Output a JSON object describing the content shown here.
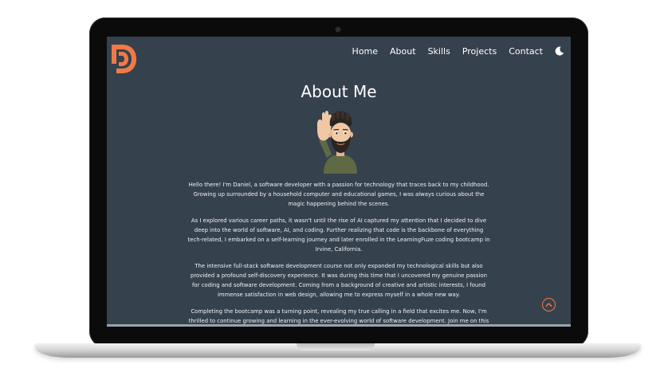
{
  "nav": {
    "items": [
      {
        "label": "Home"
      },
      {
        "label": "About"
      },
      {
        "label": "Skills"
      },
      {
        "label": "Projects"
      },
      {
        "label": "Contact"
      }
    ],
    "theme_toggle_icon": "moon-icon"
  },
  "logo": {
    "letters": "DP",
    "color": "#f07a45"
  },
  "page": {
    "title": "About Me",
    "paragraphs": [
      "Hello there! I'm Daniel, a software developer with a passion for technology that traces back to my childhood. Growing up surrounded by a household computer and educational games, I was always curious about the magic happening behind the scenes.",
      "As I explored various career paths, it wasn't until the rise of AI captured my attention that I decided to dive deep into the world of software, AI, and coding. Further realizing that code is the backbone of everything tech-related, I embarked on a self-learning journey and later enrolled in the LearningFuze coding bootcamp in Irvine, California.",
      "The intensive full-stack software development course not only expanded my technological skills but also provided a profound self-discovery experience. It was during this time that I uncovered my genuine passion for coding and software development. Coming from a background of creative and artistic interests, I found immense satisfaction in web design, allowing me to express myself in a whole new way.",
      "Completing the bootcamp was a turning point, revealing my true calling in a field that excites me. Now, I'm thrilled to continue growing and learning in the ever-evolving world of software development. Join me on this journey and let's explore the endless possibilities that technology and design bring."
    ]
  },
  "colors": {
    "accent": "#f07a45",
    "background": "#36414e",
    "text": "#ffffff"
  }
}
